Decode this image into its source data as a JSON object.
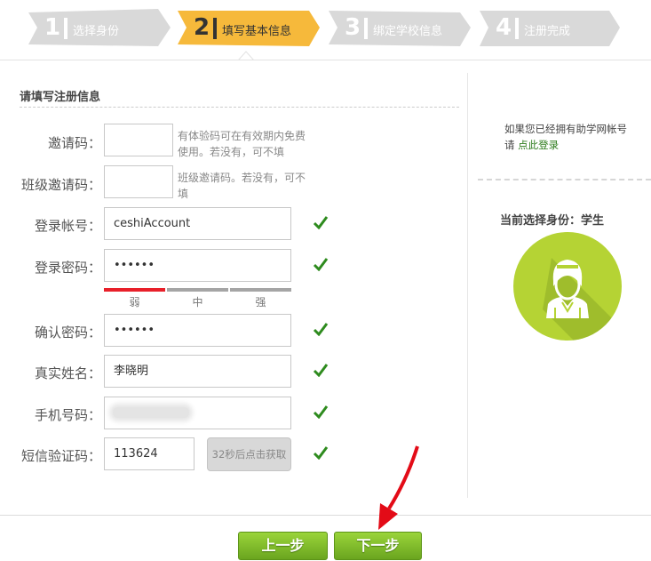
{
  "steps": [
    {
      "num": "1",
      "label": "选择身份"
    },
    {
      "num": "2",
      "label": "填写基本信息"
    },
    {
      "num": "3",
      "label": "绑定学校信息"
    },
    {
      "num": "4",
      "label": "注册完成"
    }
  ],
  "form": {
    "title": "请填写注册信息",
    "invite_code": {
      "label": "邀请码：",
      "value": "",
      "hint": "有体验码可在有效期内免费使用。若没有，可不填"
    },
    "class_invite_code": {
      "label": "班级邀请码：",
      "value": "",
      "hint": "班级邀请码。若没有，可不填"
    },
    "account": {
      "label": "登录帐号：",
      "value": "ceshiAccount"
    },
    "password": {
      "label": "登录密码：",
      "value": "••••••"
    },
    "strength": {
      "weak": "弱",
      "medium": "中",
      "strong": "强",
      "level": "weak"
    },
    "confirm_password": {
      "label": "确认密码：",
      "value": "••••••"
    },
    "real_name": {
      "label": "真实姓名：",
      "value": "李晓明"
    },
    "phone": {
      "label": "手机号码：",
      "value": ""
    },
    "sms_code": {
      "label": "短信验证码：",
      "value": "113624",
      "button": "32秒后点击获取"
    }
  },
  "side": {
    "existing_account_text": "如果您已经拥有助学网帐号",
    "please": "请",
    "login_link": "点此登录",
    "current_role": "当前选择身份：学生"
  },
  "buttons": {
    "prev": "上一步",
    "next": "下一步"
  },
  "colors": {
    "active_step": "#f6b93b",
    "inactive_step": "#d9d9d9",
    "accent_green": "#8cc63f",
    "avatar_bg": "#b5d334",
    "weak_red": "#e8202a",
    "check_green": "#2e8b1e",
    "arrow_red": "#e30b17"
  }
}
